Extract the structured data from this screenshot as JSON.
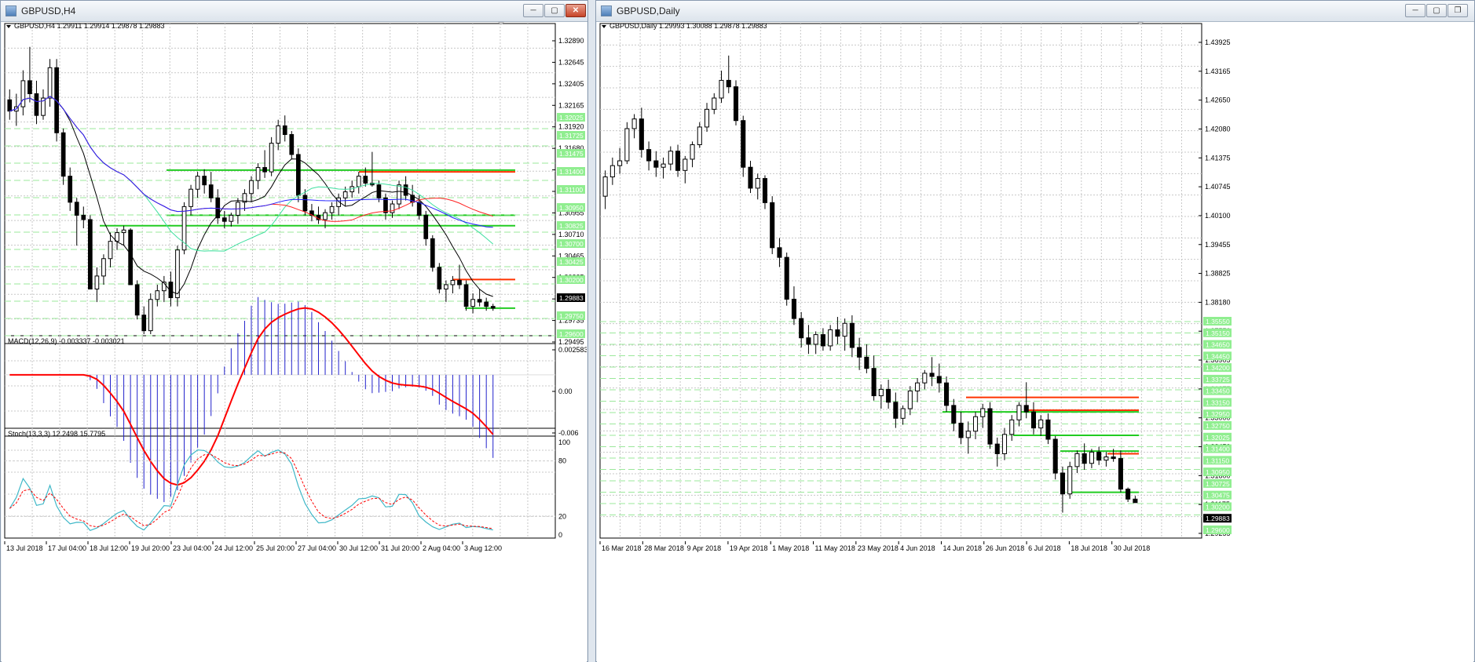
{
  "windows": {
    "left": {
      "title": "GBPUSD,H4",
      "header": "GBPUSD,H4  1.29911 1.29914 1.29878 1.29883",
      "price_axis": [
        "1.32890",
        "1.32645",
        "1.32405",
        "1.32165",
        "1.31920",
        "1.31680",
        "1.31440",
        "1.31195",
        "1.30955",
        "1.30710",
        "1.30465",
        "1.30225",
        "1.29980",
        "1.29735",
        "1.29495"
      ],
      "level_labels": [
        {
          "text": "1.32025",
          "hl": true
        },
        {
          "text": "1.31725",
          "hl": true
        },
        {
          "text": "1.31475",
          "hl": true
        },
        {
          "text": "1.31400",
          "hl": true
        },
        {
          "text": "1.31100",
          "hl": true
        },
        {
          "text": "1.30950",
          "hl": true
        },
        {
          "text": "1.30825",
          "hl": true
        },
        {
          "text": "1.30700",
          "hl": true
        },
        {
          "text": "1.30425",
          "hl": true
        },
        {
          "text": "1.30200",
          "hl": true
        },
        {
          "text": "1.29883",
          "hl": false,
          "current": true
        },
        {
          "text": "1.29750",
          "hl": true
        },
        {
          "text": "1.29600",
          "hl": true
        }
      ],
      "macd_label": "MACD(12,26,9) -0.003337 -0.003021",
      "macd_axis": [
        "0.002583",
        "0.00",
        "-0.006"
      ],
      "stoch_label": "Stoch(13,3,3) 12.2498 15.7795",
      "stoch_axis": [
        "100",
        "80",
        "20",
        "0"
      ],
      "time_axis": [
        "13 Jul 2018",
        "17 Jul 04:00",
        "18 Jul 12:00",
        "19 Jul 20:00",
        "23 Jul 04:00",
        "24 Jul 12:00",
        "25 Jul 20:00",
        "27 Jul 04:00",
        "30 Jul 12:00",
        "31 Jul 20:00",
        "2 Aug 04:00",
        "3 Aug 12:00"
      ]
    },
    "right": {
      "title": "GBPUSD,Daily",
      "header": "GBPUSD,Daily  1.29993 1.30088 1.29878 1.29883",
      "price_axis": [
        "1.43925",
        "1.43165",
        "1.42650",
        "1.42080",
        "1.41375",
        "1.40745",
        "1.40100",
        "1.39455",
        "1.38825",
        "1.38180",
        "1.37550",
        "1.36905",
        "1.36275",
        "1.35000",
        "1.32450",
        "1.31800",
        "1.31175",
        "1.29255"
      ],
      "level_labels": [
        {
          "text": "1.35550",
          "hl": true
        },
        {
          "text": "1.35150",
          "hl": true
        },
        {
          "text": "1.34650",
          "hl": true
        },
        {
          "text": "1.34450",
          "hl": true
        },
        {
          "text": "1.34200",
          "hl": true
        },
        {
          "text": "1.33725",
          "hl": true
        },
        {
          "text": "1.33450",
          "hl": true
        },
        {
          "text": "1.33150",
          "hl": true
        },
        {
          "text": "1.32950",
          "hl": true
        },
        {
          "text": "1.32750",
          "hl": true
        },
        {
          "text": "1.32025",
          "hl": true
        },
        {
          "text": "1.31400",
          "hl": true
        },
        {
          "text": "1.31150",
          "hl": true
        },
        {
          "text": "1.30950",
          "hl": true
        },
        {
          "text": "1.30725",
          "hl": true
        },
        {
          "text": "1.30475",
          "hl": true
        },
        {
          "text": "1.30200",
          "hl": true
        },
        {
          "text": "1.29883",
          "hl": false,
          "current": true
        },
        {
          "text": "1.29600",
          "hl": true
        }
      ],
      "time_axis": [
        "16 Mar 2018",
        "28 Mar 2018",
        "9 Apr 2018",
        "19 Apr 2018",
        "1 May 2018",
        "11 May 2018",
        "23 May 2018",
        "4 Jun 2018",
        "14 Jun 2018",
        "26 Jun 2018",
        "6 Jul 2018",
        "18 Jul 2018",
        "30 Jul 2018"
      ]
    }
  },
  "chart_data": [
    {
      "type": "candlestick",
      "symbol": "GBPUSD",
      "timeframe": "H4",
      "ohlc": [
        [
          1.3228,
          1.324,
          1.3205,
          1.3215
        ],
        [
          1.3215,
          1.3235,
          1.3198,
          1.322
        ],
        [
          1.322,
          1.3262,
          1.321,
          1.325
        ],
        [
          1.325,
          1.3289,
          1.3225,
          1.3235
        ],
        [
          1.3235,
          1.325,
          1.32,
          1.321
        ],
        [
          1.321,
          1.324,
          1.3205,
          1.323
        ],
        [
          1.323,
          1.3275,
          1.322,
          1.3265
        ],
        [
          1.3265,
          1.3275,
          1.318,
          1.319
        ],
        [
          1.319,
          1.3195,
          1.313,
          1.314
        ],
        [
          1.314,
          1.315,
          1.31,
          1.311
        ],
        [
          1.311,
          1.3115,
          1.306,
          1.3095
        ],
        [
          1.3095,
          1.3105,
          1.308,
          1.309
        ],
        [
          1.309,
          1.3095,
          1.302,
          1.301
        ],
        [
          1.301,
          1.3035,
          1.2995,
          1.3025
        ],
        [
          1.3025,
          1.305,
          1.3015,
          1.3045
        ],
        [
          1.3045,
          1.3075,
          1.3035,
          1.3065
        ],
        [
          1.3065,
          1.308,
          1.3055,
          1.3075
        ],
        [
          1.3075,
          1.3083,
          1.306,
          1.3078
        ],
        [
          1.3078,
          1.308,
          1.302,
          1.3015
        ],
        [
          1.3015,
          1.302,
          1.2975,
          1.298
        ],
        [
          1.298,
          1.299,
          1.2958,
          1.2962
        ],
        [
          1.2962,
          1.3005,
          1.2958,
          1.2998
        ],
        [
          1.2998,
          1.3015,
          1.299,
          1.3008
        ],
        [
          1.3008,
          1.3025,
          1.2995,
          1.3018
        ],
        [
          1.3018,
          1.303,
          1.299,
          1.3
        ],
        [
          1.3,
          1.306,
          1.299,
          1.3055
        ],
        [
          1.3055,
          1.311,
          1.305,
          1.3105
        ],
        [
          1.3105,
          1.313,
          1.3095,
          1.3125
        ],
        [
          1.3125,
          1.3145,
          1.3115,
          1.314
        ],
        [
          1.314,
          1.3148,
          1.312,
          1.313
        ],
        [
          1.313,
          1.3145,
          1.311,
          1.3115
        ],
        [
          1.3115,
          1.3125,
          1.3085,
          1.3092
        ],
        [
          1.3092,
          1.31,
          1.308,
          1.3088
        ],
        [
          1.3088,
          1.3098,
          1.3082,
          1.3095
        ],
        [
          1.3095,
          1.3115,
          1.3085,
          1.311
        ],
        [
          1.311,
          1.3125,
          1.31,
          1.312
        ],
        [
          1.312,
          1.314,
          1.311,
          1.3135
        ],
        [
          1.3135,
          1.3155,
          1.3125,
          1.315
        ],
        [
          1.315,
          1.317,
          1.3138,
          1.3145
        ],
        [
          1.3145,
          1.3185,
          1.314,
          1.3178
        ],
        [
          1.3178,
          1.3205,
          1.317,
          1.3198
        ],
        [
          1.3198,
          1.321,
          1.318,
          1.3188
        ],
        [
          1.3188,
          1.3192,
          1.316,
          1.3165
        ],
        [
          1.3165,
          1.3172,
          1.311,
          1.3118
        ],
        [
          1.3118,
          1.3125,
          1.3095,
          1.31
        ],
        [
          1.31,
          1.3108,
          1.3088,
          1.3095
        ],
        [
          1.3095,
          1.3105,
          1.3085,
          1.309
        ],
        [
          1.309,
          1.3102,
          1.308,
          1.3098
        ],
        [
          1.3098,
          1.311,
          1.309,
          1.3105
        ],
        [
          1.3105,
          1.312,
          1.3095,
          1.3115
        ],
        [
          1.3115,
          1.3128,
          1.3105,
          1.3122
        ],
        [
          1.3122,
          1.3135,
          1.3115,
          1.3128
        ],
        [
          1.3128,
          1.3145,
          1.312,
          1.314
        ],
        [
          1.314,
          1.315,
          1.3128,
          1.3132
        ],
        [
          1.3132,
          1.3168,
          1.3128,
          1.313
        ],
        [
          1.313,
          1.3135,
          1.311,
          1.3115
        ],
        [
          1.3115,
          1.312,
          1.309,
          1.3098
        ],
        [
          1.3098,
          1.3112,
          1.3092,
          1.3108
        ],
        [
          1.3108,
          1.3135,
          1.3102,
          1.313
        ],
        [
          1.313,
          1.314,
          1.3112,
          1.3118
        ],
        [
          1.3118,
          1.313,
          1.3105,
          1.311
        ],
        [
          1.311,
          1.3118,
          1.309,
          1.3095
        ],
        [
          1.3095,
          1.31,
          1.306,
          1.3068
        ],
        [
          1.3068,
          1.3072,
          1.303,
          1.3035
        ],
        [
          1.3035,
          1.304,
          1.3005,
          1.301
        ],
        [
          1.301,
          1.302,
          1.2995,
          1.3015
        ],
        [
          1.3015,
          1.3025,
          1.3005,
          1.302
        ],
        [
          1.302,
          1.3038,
          1.301,
          1.3015
        ],
        [
          1.3015,
          1.302,
          1.2985,
          1.299
        ],
        [
          1.299,
          1.3005,
          1.2982,
          1.2998
        ],
        [
          1.2998,
          1.301,
          1.299,
          1.2995
        ],
        [
          1.2995,
          1.3,
          1.2985,
          1.299
        ],
        [
          1.299,
          1.2993,
          1.2985,
          1.2988
        ]
      ],
      "price_range": [
        1.2949,
        1.3296
      ],
      "horizontal_levels": {
        "green": [
          1.3147,
          1.3095,
          1.3083,
          1.2988
        ],
        "red": [
          1.3145,
          1.3021
        ]
      },
      "macd": {
        "params": "12,26,9",
        "value": -0.003337,
        "signal": -0.003021,
        "range": [
          -0.006,
          0.002583
        ]
      },
      "stochastic": {
        "params": "13,3,3",
        "main": 12.2498,
        "signal": 15.7795,
        "range": [
          0,
          100
        ]
      }
    },
    {
      "type": "candlestick",
      "symbol": "GBPUSD",
      "timeframe": "Daily",
      "ohlc": [
        [
          1.394,
          1.402,
          1.39,
          1.4
        ],
        [
          1.4,
          1.406,
          1.3975,
          1.4035
        ],
        [
          1.4035,
          1.409,
          1.401,
          1.405
        ],
        [
          1.405,
          1.417,
          1.404,
          1.415
        ],
        [
          1.415,
          1.4195,
          1.412,
          1.418
        ],
        [
          1.418,
          1.4215,
          1.406,
          1.4085
        ],
        [
          1.4085,
          1.411,
          1.402,
          1.405
        ],
        [
          1.405,
          1.408,
          1.4,
          1.403
        ],
        [
          1.403,
          1.406,
          1.3995,
          1.404
        ],
        [
          1.404,
          1.4095,
          1.402,
          1.408
        ],
        [
          1.408,
          1.41,
          1.4,
          1.402
        ],
        [
          1.402,
          1.4065,
          1.398,
          1.4055
        ],
        [
          1.4055,
          1.411,
          1.403,
          1.41
        ],
        [
          1.41,
          1.417,
          1.409,
          1.4155
        ],
        [
          1.4155,
          1.423,
          1.414,
          1.421
        ],
        [
          1.421,
          1.426,
          1.4195,
          1.4245
        ],
        [
          1.4245,
          1.433,
          1.423,
          1.43
        ],
        [
          1.43,
          1.4377,
          1.426,
          1.428
        ],
        [
          1.428,
          1.43,
          1.416,
          1.4175
        ],
        [
          1.4175,
          1.419,
          1.4,
          1.403
        ],
        [
          1.403,
          1.405,
          1.395,
          1.3965
        ],
        [
          1.3965,
          1.401,
          1.393,
          1.3995
        ],
        [
          1.3995,
          1.4005,
          1.39,
          1.392
        ],
        [
          1.392,
          1.394,
          1.376,
          1.378
        ],
        [
          1.378,
          1.381,
          1.372,
          1.375
        ],
        [
          1.375,
          1.3765,
          1.36,
          1.362
        ],
        [
          1.362,
          1.366,
          1.354,
          1.356
        ],
        [
          1.356,
          1.358,
          1.347,
          1.35
        ],
        [
          1.35,
          1.354,
          1.345,
          1.348
        ],
        [
          1.348,
          1.352,
          1.345,
          1.351
        ],
        [
          1.351,
          1.353,
          1.346,
          1.3475
        ],
        [
          1.3475,
          1.354,
          1.346,
          1.3525
        ],
        [
          1.3525,
          1.3565,
          1.348,
          1.3505
        ],
        [
          1.3505,
          1.356,
          1.346,
          1.3545
        ],
        [
          1.3545,
          1.357,
          1.344,
          1.347
        ],
        [
          1.347,
          1.35,
          1.34,
          1.344
        ],
        [
          1.344,
          1.348,
          1.339,
          1.3405
        ],
        [
          1.3405,
          1.3445,
          1.3305,
          1.332
        ],
        [
          1.332,
          1.3355,
          1.328,
          1.334
        ],
        [
          1.334,
          1.337,
          1.328,
          1.33
        ],
        [
          1.33,
          1.333,
          1.322,
          1.325
        ],
        [
          1.325,
          1.329,
          1.323,
          1.328
        ],
        [
          1.328,
          1.335,
          1.326,
          1.3335
        ],
        [
          1.3335,
          1.3375,
          1.33,
          1.336
        ],
        [
          1.336,
          1.34,
          1.334,
          1.339
        ],
        [
          1.339,
          1.344,
          1.335,
          1.338
        ],
        [
          1.338,
          1.342,
          1.333,
          1.336
        ],
        [
          1.336,
          1.338,
          1.327,
          1.329
        ],
        [
          1.329,
          1.331,
          1.321,
          1.3235
        ],
        [
          1.3235,
          1.327,
          1.317,
          1.319
        ],
        [
          1.319,
          1.324,
          1.314,
          1.321
        ],
        [
          1.321,
          1.327,
          1.3185,
          1.3255
        ],
        [
          1.3255,
          1.3295,
          1.322,
          1.328
        ],
        [
          1.328,
          1.33,
          1.3155,
          1.317
        ],
        [
          1.317,
          1.319,
          1.31,
          1.314
        ],
        [
          1.314,
          1.322,
          1.312,
          1.32
        ],
        [
          1.32,
          1.326,
          1.318,
          1.3245
        ],
        [
          1.3245,
          1.33,
          1.3225,
          1.329
        ],
        [
          1.329,
          1.3362,
          1.325,
          1.327
        ],
        [
          1.327,
          1.33,
          1.32,
          1.322
        ],
        [
          1.322,
          1.326,
          1.3195,
          1.3245
        ],
        [
          1.3245,
          1.3265,
          1.317,
          1.3185
        ],
        [
          1.3185,
          1.3195,
          1.306,
          1.308
        ],
        [
          1.308,
          1.31,
          1.2957,
          1.3015
        ],
        [
          1.3015,
          1.3115,
          1.3,
          1.31
        ],
        [
          1.31,
          1.315,
          1.308,
          1.314
        ],
        [
          1.314,
          1.3172,
          1.309,
          1.311
        ],
        [
          1.311,
          1.3155,
          1.3095,
          1.3145
        ],
        [
          1.3145,
          1.3162,
          1.3105,
          1.312
        ],
        [
          1.312,
          1.3145,
          1.31,
          1.313
        ],
        [
          1.313,
          1.3155,
          1.3115,
          1.3125
        ],
        [
          1.3125,
          1.315,
          1.302,
          1.303
        ],
        [
          1.303,
          1.3035,
          1.299,
          1.2999
        ],
        [
          1.2999,
          1.3009,
          1.2988,
          1.2988
        ]
      ],
      "price_range": [
        1.2912,
        1.4418
      ],
      "horizontal_levels": {
        "green": [
          1.327,
          1.3197,
          1.3148,
          1.302
        ],
        "red": [
          1.3315,
          1.3275,
          1.314
        ]
      }
    }
  ]
}
